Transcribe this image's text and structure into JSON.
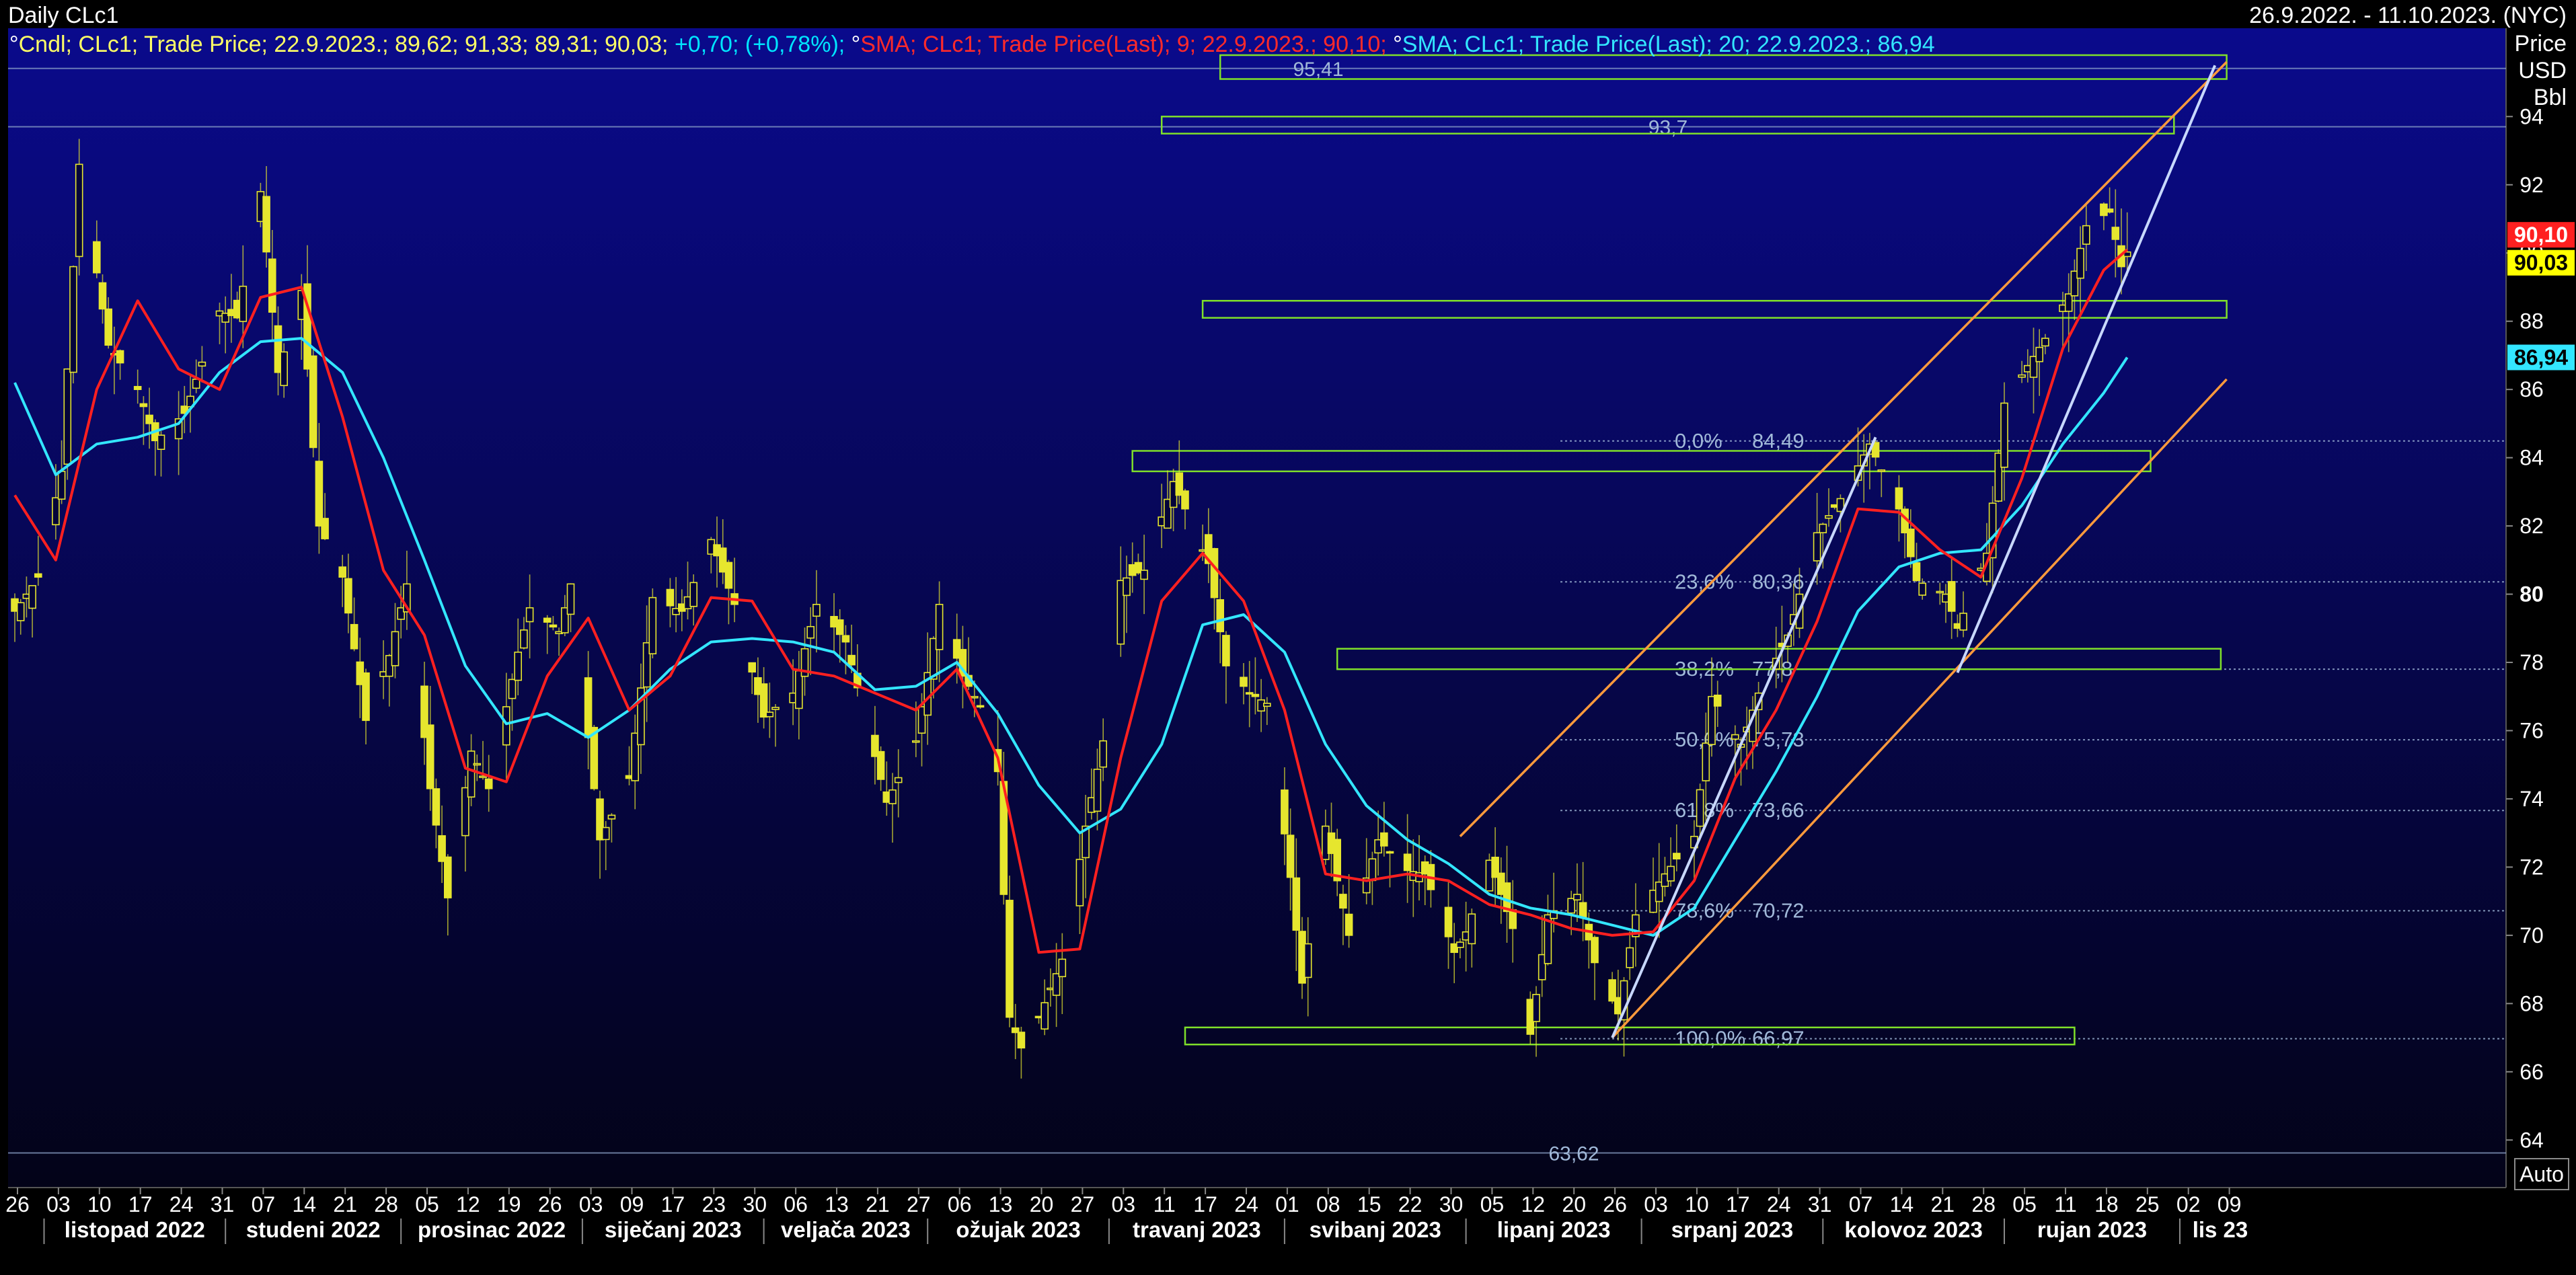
{
  "header": {
    "title": "Daily  CLc1",
    "date_range": "26.9.2022. - 11.10.2023. (NYC)"
  },
  "legend": [
    {
      "marker": "°",
      "text": "Cndl; CLc1; Trade Price; 22.9.2023.; 89,62; 91,33; 89,31; 90,03; ",
      "color": "#ffff66"
    },
    {
      "marker": "",
      "text": "+0,70; (+0,78%); ",
      "color": "#00e5ff"
    },
    {
      "marker": "°",
      "text": "SMA; CLc1; Trade Price(Last);  9; 22.9.2023.; 90,10; ",
      "color": "#ff2a2a"
    },
    {
      "marker": "°",
      "text": "SMA; CLc1; Trade Price(Last);  20; 22.9.2023.; 86,94",
      "color": "#33e6ff"
    }
  ],
  "axis": {
    "y_title": [
      "Price",
      "USD",
      "Bbl"
    ],
    "auto_label": "Auto"
  },
  "colors": {
    "candle": "#e6e62e",
    "sma9": "#ff2020",
    "sma20": "#33e6ff",
    "channel": "#ff9a3c",
    "trendline": "#c8d8ff",
    "zone": "#7fe02a",
    "fib": "#a0b8d8",
    "level": "#8aa0c8"
  },
  "chart_data": {
    "type": "candlestick",
    "title": "Daily  CLc1",
    "instrument": "CLc1",
    "ylabel": "Price USD Bbl",
    "ylim": [
      63,
      95.8
    ],
    "yticks": [
      64,
      66,
      68,
      70,
      72,
      74,
      76,
      78,
      80,
      82,
      84,
      86,
      88,
      90,
      92,
      94
    ],
    "x_day_ticks": [
      "26",
      "03",
      "10",
      "17",
      "24",
      "31",
      "07",
      "14",
      "21",
      "28",
      "05",
      "12",
      "19",
      "26",
      "03",
      "09",
      "17",
      "23",
      "30",
      "06",
      "13",
      "21",
      "27",
      "06",
      "13",
      "20",
      "27",
      "03",
      "11",
      "17",
      "24",
      "01",
      "08",
      "15",
      "22",
      "30",
      "05",
      "12",
      "20",
      "26",
      "03",
      "10",
      "17",
      "24",
      "31",
      "07",
      "14",
      "21",
      "28",
      "05",
      "11",
      "18",
      "25",
      "02",
      "09"
    ],
    "x_months": [
      "listopad 2022",
      "studeni 2022",
      "prosinac 2022",
      "siječanj 2023",
      "veljača 2023",
      "ožujak 2023",
      "travanj 2023",
      "svibanj 2023",
      "lipanj 2023",
      "srpanj 2023",
      "kolovoz 2023",
      "rujan 2023",
      "lis 23"
    ],
    "last_candle": {
      "date": "22.9.2023.",
      "open": 89.62,
      "high": 91.33,
      "low": 89.31,
      "close": 90.03,
      "change": "+0,70",
      "change_pct": "(+0,78%)"
    },
    "price_badges": [
      {
        "label": "90,10",
        "value": 90.1,
        "bg": "#ff2020",
        "fg": "#ffffff"
      },
      {
        "label": "90,03",
        "value": 90.03,
        "bg": "#ffff00",
        "fg": "#000000"
      },
      {
        "label": "86,94",
        "value": 86.94,
        "bg": "#33e6ff",
        "fg": "#000000"
      }
    ],
    "levels": [
      {
        "value": 95.41,
        "label": "95,41"
      },
      {
        "value": 93.7,
        "label": "93,7"
      },
      {
        "value": 63.62,
        "label": "63,62"
      }
    ],
    "fibonacci": [
      {
        "pct": "0,0%",
        "value": 84.49,
        "label": "84,49"
      },
      {
        "pct": "23,6%",
        "value": 80.36,
        "label": "80,36"
      },
      {
        "pct": "38,2%",
        "value": 77.8,
        "label": "77,8"
      },
      {
        "pct": "50,0%",
        "value": 75.73,
        "label": "75,73"
      },
      {
        "pct": "61,8%",
        "value": 73.66,
        "label": "73,66"
      },
      {
        "pct": "78,6%",
        "value": 70.72,
        "label": "70,72"
      },
      {
        "pct": "100,0%",
        "value": 66.97,
        "label": "66,97"
      }
    ],
    "zones": [
      {
        "from": "2023-04-20",
        "to": "2023-10-09",
        "low": 95.1,
        "high": 95.8
      },
      {
        "from": "2023-04-10",
        "to": "2023-09-30",
        "low": 93.5,
        "high": 94.0
      },
      {
        "from": "2023-04-17",
        "to": "2023-10-09",
        "low": 88.1,
        "high": 88.6
      },
      {
        "from": "2023-04-05",
        "to": "2023-09-26",
        "low": 83.6,
        "high": 84.2
      },
      {
        "from": "2023-05-10",
        "to": "2023-10-08",
        "low": 77.8,
        "high": 78.4
      },
      {
        "from": "2023-04-14",
        "to": "2023-09-13",
        "low": 66.8,
        "high": 67.3
      }
    ],
    "channel": [
      {
        "from": {
          "date": "2023-05-31",
          "price": 72.9
        },
        "to": {
          "date": "2023-10-09",
          "price": 95.6
        }
      },
      {
        "from": {
          "date": "2023-06-26",
          "price": 67.0
        },
        "to": {
          "date": "2023-10-09",
          "price": 86.3
        }
      }
    ],
    "trendlines": [
      {
        "from": {
          "date": "2023-06-26",
          "price": 67.0
        },
        "to": {
          "date": "2023-08-10",
          "price": 84.6
        }
      },
      {
        "from": {
          "date": "2023-08-24",
          "price": 77.7
        },
        "to": {
          "date": "2023-10-07",
          "price": 95.5
        }
      }
    ],
    "price_path": [
      [
        "2022-09-26",
        79.5
      ],
      [
        "2022-09-30",
        80.5
      ],
      [
        "2022-10-04",
        83.6
      ],
      [
        "2022-10-07",
        92.6
      ],
      [
        "2022-10-12",
        87.3
      ],
      [
        "2022-10-17",
        86.0
      ],
      [
        "2022-10-20",
        84.5
      ],
      [
        "2022-10-25",
        85.3
      ],
      [
        "2022-10-31",
        88.3
      ],
      [
        "2022-11-03",
        88.1
      ],
      [
        "2022-11-07",
        91.8
      ],
      [
        "2022-11-10",
        86.5
      ],
      [
        "2022-11-14",
        88.9
      ],
      [
        "2022-11-17",
        82.0
      ],
      [
        "2022-11-21",
        80.5
      ],
      [
        "2022-11-25",
        76.3
      ],
      [
        "2022-11-29",
        78.2
      ],
      [
        "2022-12-02",
        80.3
      ],
      [
        "2022-12-06",
        74.3
      ],
      [
        "2022-12-09",
        71.1
      ],
      [
        "2022-12-13",
        75.4
      ],
      [
        "2022-12-16",
        74.3
      ],
      [
        "2022-12-21",
        78.3
      ],
      [
        "2022-12-23",
        79.6
      ],
      [
        "2022-12-28",
        78.9
      ],
      [
        "2022-12-30",
        80.3
      ],
      [
        "2023-01-04",
        72.8
      ],
      [
        "2023-01-09",
        74.6
      ],
      [
        "2023-01-13",
        79.9
      ],
      [
        "2023-01-18",
        79.5
      ],
      [
        "2023-01-23",
        81.6
      ],
      [
        "2023-01-27",
        79.7
      ],
      [
        "2023-02-01",
        76.4
      ],
      [
        "2023-02-06",
        77.1
      ],
      [
        "2023-02-10",
        79.7
      ],
      [
        "2023-02-15",
        78.6
      ],
      [
        "2023-02-22",
        73.9
      ],
      [
        "2023-02-27",
        75.7
      ],
      [
        "2023-03-03",
        79.7
      ],
      [
        "2023-03-07",
        77.6
      ],
      [
        "2023-03-10",
        76.7
      ],
      [
        "2023-03-13",
        74.8
      ],
      [
        "2023-03-15",
        67.6
      ],
      [
        "2023-03-17",
        66.7
      ],
      [
        "2023-03-20",
        67.6
      ],
      [
        "2023-03-24",
        69.3
      ],
      [
        "2023-03-28",
        73.2
      ],
      [
        "2023-03-31",
        75.7
      ],
      [
        "2023-04-03",
        80.4
      ],
      [
        "2023-04-07",
        80.7
      ],
      [
        "2023-04-12",
        83.3
      ],
      [
        "2023-04-18",
        80.9
      ],
      [
        "2023-04-21",
        77.9
      ],
      [
        "2023-04-25",
        77.1
      ],
      [
        "2023-04-28",
        76.8
      ],
      [
        "2023-05-02",
        71.7
      ],
      [
        "2023-05-04",
        68.6
      ],
      [
        "2023-05-08",
        73.2
      ],
      [
        "2023-05-12",
        70.0
      ],
      [
        "2023-05-17",
        72.8
      ],
      [
        "2023-05-22",
        71.9
      ],
      [
        "2023-05-25",
        71.8
      ],
      [
        "2023-05-30",
        69.5
      ],
      [
        "2023-06-01",
        70.1
      ],
      [
        "2023-06-05",
        72.2
      ],
      [
        "2023-06-09",
        70.2
      ],
      [
        "2023-06-12",
        67.1
      ],
      [
        "2023-06-15",
        70.6
      ],
      [
        "2023-06-20",
        71.2
      ],
      [
        "2023-06-23",
        69.2
      ],
      [
        "2023-06-27",
        67.7
      ],
      [
        "2023-06-30",
        70.6
      ],
      [
        "2023-07-05",
        71.8
      ],
      [
        "2023-07-10",
        72.9
      ],
      [
        "2023-07-13",
        77.0
      ],
      [
        "2023-07-18",
        75.6
      ],
      [
        "2023-07-21",
        77.1
      ],
      [
        "2023-07-26",
        78.8
      ],
      [
        "2023-07-31",
        81.8
      ],
      [
        "2023-08-04",
        82.8
      ],
      [
        "2023-08-09",
        84.4
      ],
      [
        "2023-08-14",
        82.5
      ],
      [
        "2023-08-17",
        80.4
      ],
      [
        "2023-08-22",
        80.0
      ],
      [
        "2023-08-24",
        79.0
      ],
      [
        "2023-08-29",
        81.2
      ],
      [
        "2023-09-01",
        85.6
      ],
      [
        "2023-09-05",
        86.7
      ],
      [
        "2023-09-08",
        87.5
      ],
      [
        "2023-09-12",
        88.8
      ],
      [
        "2023-09-15",
        90.8
      ],
      [
        "2023-09-19",
        91.2
      ],
      [
        "2023-09-21",
        89.6
      ],
      [
        "2023-09-22",
        90.03
      ]
    ],
    "sma9_path": [
      [
        "2022-09-26",
        82.9
      ],
      [
        "2022-10-03",
        81.0
      ],
      [
        "2022-10-10",
        86.0
      ],
      [
        "2022-10-17",
        88.6
      ],
      [
        "2022-10-24",
        86.6
      ],
      [
        "2022-10-31",
        86.0
      ],
      [
        "2022-11-07",
        88.7
      ],
      [
        "2022-11-14",
        89.0
      ],
      [
        "2022-11-21",
        85.2
      ],
      [
        "2022-11-28",
        80.7
      ],
      [
        "2022-12-05",
        78.8
      ],
      [
        "2022-12-12",
        74.9
      ],
      [
        "2022-12-19",
        74.5
      ],
      [
        "2022-12-26",
        77.6
      ],
      [
        "2023-01-02",
        79.3
      ],
      [
        "2023-01-09",
        76.6
      ],
      [
        "2023-01-16",
        77.6
      ],
      [
        "2023-01-23",
        79.9
      ],
      [
        "2023-01-30",
        79.8
      ],
      [
        "2023-02-06",
        77.8
      ],
      [
        "2023-02-13",
        77.6
      ],
      [
        "2023-02-20",
        77.1
      ],
      [
        "2023-02-27",
        76.6
      ],
      [
        "2023-03-06",
        77.8
      ],
      [
        "2023-03-13",
        75.2
      ],
      [
        "2023-03-20",
        69.5
      ],
      [
        "2023-03-27",
        69.6
      ],
      [
        "2023-04-03",
        75.2
      ],
      [
        "2023-04-10",
        79.8
      ],
      [
        "2023-04-17",
        81.2
      ],
      [
        "2023-04-24",
        79.8
      ],
      [
        "2023-05-01",
        76.6
      ],
      [
        "2023-05-08",
        71.8
      ],
      [
        "2023-05-15",
        71.6
      ],
      [
        "2023-05-22",
        71.8
      ],
      [
        "2023-05-29",
        71.6
      ],
      [
        "2023-06-05",
        70.9
      ],
      [
        "2023-06-12",
        70.6
      ],
      [
        "2023-06-19",
        70.2
      ],
      [
        "2023-06-26",
        70.0
      ],
      [
        "2023-07-03",
        70.1
      ],
      [
        "2023-07-10",
        71.6
      ],
      [
        "2023-07-17",
        74.6
      ],
      [
        "2023-07-24",
        76.6
      ],
      [
        "2023-07-31",
        79.2
      ],
      [
        "2023-08-07",
        82.5
      ],
      [
        "2023-08-14",
        82.4
      ],
      [
        "2023-08-21",
        81.3
      ],
      [
        "2023-08-28",
        80.5
      ],
      [
        "2023-09-04",
        83.4
      ],
      [
        "2023-09-11",
        87.2
      ],
      [
        "2023-09-18",
        89.5
      ],
      [
        "2023-09-22",
        90.1
      ]
    ],
    "sma20_path": [
      [
        "2022-09-26",
        86.2
      ],
      [
        "2022-10-03",
        83.5
      ],
      [
        "2022-10-10",
        84.4
      ],
      [
        "2022-10-17",
        84.6
      ],
      [
        "2022-10-24",
        85.0
      ],
      [
        "2022-10-31",
        86.5
      ],
      [
        "2022-11-07",
        87.4
      ],
      [
        "2022-11-14",
        87.5
      ],
      [
        "2022-11-21",
        86.5
      ],
      [
        "2022-11-28",
        84.0
      ],
      [
        "2022-12-05",
        81.0
      ],
      [
        "2022-12-12",
        77.9
      ],
      [
        "2022-12-19",
        76.2
      ],
      [
        "2022-12-26",
        76.5
      ],
      [
        "2023-01-02",
        75.8
      ],
      [
        "2023-01-09",
        76.6
      ],
      [
        "2023-01-16",
        77.8
      ],
      [
        "2023-01-23",
        78.6
      ],
      [
        "2023-01-30",
        78.7
      ],
      [
        "2023-02-06",
        78.6
      ],
      [
        "2023-02-13",
        78.3
      ],
      [
        "2023-02-20",
        77.2
      ],
      [
        "2023-02-27",
        77.3
      ],
      [
        "2023-03-06",
        78.0
      ],
      [
        "2023-03-13",
        76.5
      ],
      [
        "2023-03-20",
        74.4
      ],
      [
        "2023-03-27",
        73.0
      ],
      [
        "2023-04-03",
        73.7
      ],
      [
        "2023-04-10",
        75.6
      ],
      [
        "2023-04-17",
        79.1
      ],
      [
        "2023-04-24",
        79.4
      ],
      [
        "2023-05-01",
        78.3
      ],
      [
        "2023-05-08",
        75.6
      ],
      [
        "2023-05-15",
        73.8
      ],
      [
        "2023-05-22",
        72.8
      ],
      [
        "2023-05-29",
        72.1
      ],
      [
        "2023-06-05",
        71.2
      ],
      [
        "2023-06-12",
        70.8
      ],
      [
        "2023-06-19",
        70.6
      ],
      [
        "2023-06-26",
        70.3
      ],
      [
        "2023-07-03",
        70.0
      ],
      [
        "2023-07-10",
        70.8
      ],
      [
        "2023-07-17",
        72.8
      ],
      [
        "2023-07-24",
        74.8
      ],
      [
        "2023-07-31",
        77.0
      ],
      [
        "2023-08-07",
        79.5
      ],
      [
        "2023-08-14",
        80.8
      ],
      [
        "2023-08-21",
        81.2
      ],
      [
        "2023-08-28",
        81.3
      ],
      [
        "2023-09-04",
        82.6
      ],
      [
        "2023-09-11",
        84.4
      ],
      [
        "2023-09-18",
        85.9
      ],
      [
        "2023-09-22",
        86.94
      ]
    ]
  }
}
